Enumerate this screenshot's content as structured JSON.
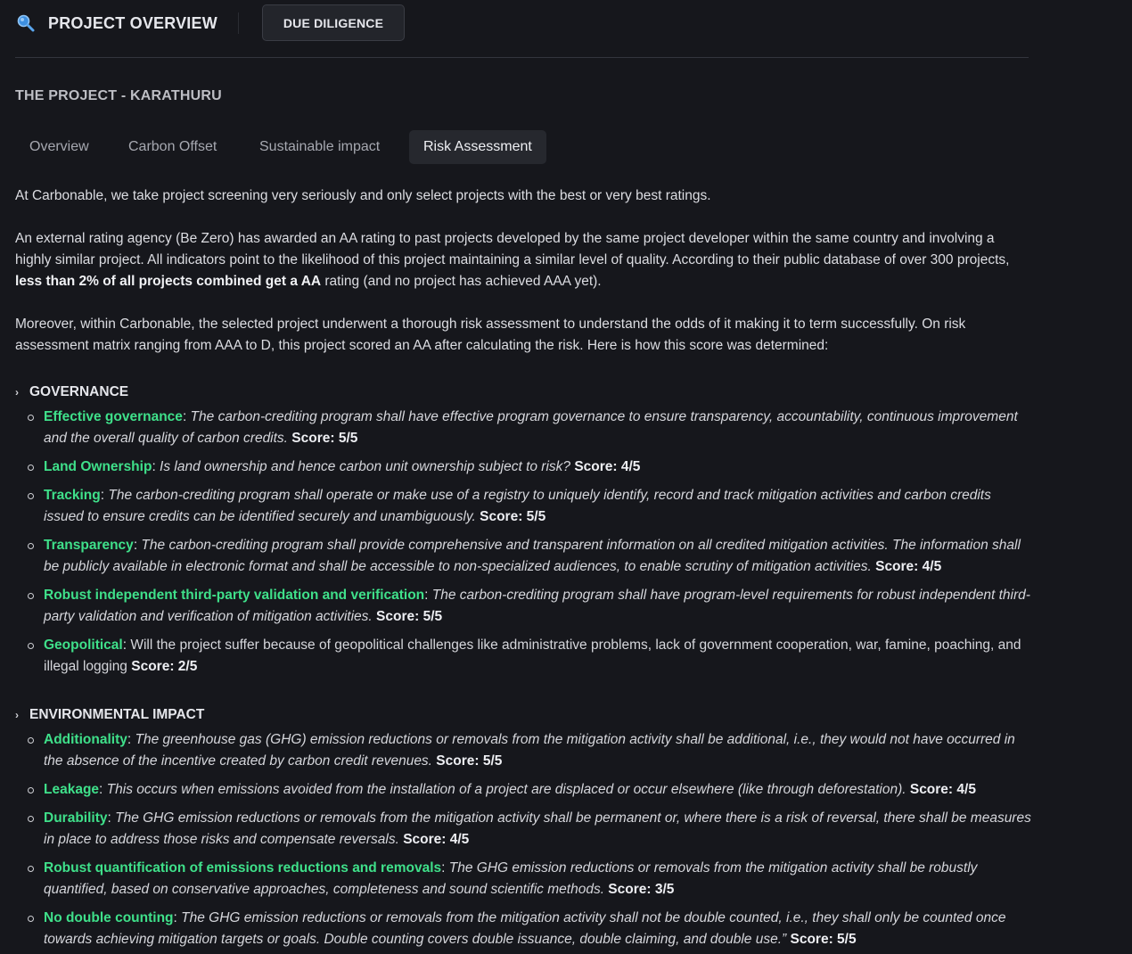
{
  "header": {
    "title": "PROJECT OVERVIEW",
    "due_diligence_label": "DUE DILIGENCE",
    "icon": "search-icon"
  },
  "project": {
    "title": "THE PROJECT - KARATHURU"
  },
  "tabs": [
    {
      "label": "Overview",
      "active": false
    },
    {
      "label": "Carbon Offset",
      "active": false
    },
    {
      "label": "Sustainable impact",
      "active": false
    },
    {
      "label": "Risk Assessment",
      "active": true
    }
  ],
  "intro": {
    "p1": "At Carbonable, we take project screening very seriously and only select projects with the best or very best ratings.",
    "p2_part1": "An external rating agency (Be Zero) has awarded an AA rating to past projects developed by the same project developer within the same country and involving a highly similar project. All indicators point to the likelihood of this project maintaining a similar level of quality. According to their public database of over 300 projects, ",
    "p2_bold": "less than 2% of all projects combined get a AA",
    "p2_part2": " rating (and no project has achieved AAA yet).",
    "p3": "Moreover, within Carbonable, the selected project underwent a thorough risk assessment to understand the odds of it making it to term successfully. On risk assessment matrix ranging from AAA to D, this project scored an AA after calculating the risk. Here is how this score was determined:"
  },
  "sections": [
    {
      "title": "GOVERNANCE",
      "items": [
        {
          "term": "Effective governance",
          "sep": ":",
          "desc": " The carbon-crediting program shall have effective program governance to ensure transparency, accountability, continuous improvement and the overall quality of carbon credits.",
          "score": " Score: 5/5",
          "italic": true
        },
        {
          "term": "Land Ownership",
          "sep": ":",
          "desc": " Is land ownership and hence carbon unit ownership subject to risk?",
          "score": " Score: 4/5",
          "italic": true
        },
        {
          "term": "Tracking",
          "sep": ":",
          "desc": " The carbon-crediting program shall operate or make use of a registry to uniquely identify, record and track mitigation activities and carbon credits issued to ensure credits can be identified securely and unambiguously.",
          "score": " Score: 5/5",
          "italic": true
        },
        {
          "term": "Transparency",
          "sep": ":",
          "desc": " The carbon-crediting program shall provide comprehensive and transparent information on all credited mitigation activities. The information shall be publicly available in electronic format and shall be accessible to non-specialized audiences, to enable scrutiny of mitigation activities.",
          "score": " Score: 4/5",
          "italic": true
        },
        {
          "term": "Robust independent third-party validation and verification",
          "sep": ":",
          "desc": " The carbon-crediting program shall have program-level requirements for robust independent third-party validation and verification of mitigation activities.",
          "score": " Score: 5/5",
          "italic": true
        },
        {
          "term": "Geopolitical",
          "sep": ":",
          "desc": " Will the project suffer because of geopolitical challenges like administrative problems, lack of government cooperation, war, famine, poaching, and illegal logging",
          "score": " Score: 2/5",
          "italic": false
        }
      ]
    },
    {
      "title": "ENVIRONMENTAL IMPACT",
      "items": [
        {
          "term": "Additionality",
          "sep": ":",
          "desc": " The greenhouse gas (GHG) emission reductions or removals from the mitigation activity shall be additional, i.e., they would not have occurred in the absence of the incentive created by carbon credit revenues.",
          "score": " Score: 5/5",
          "italic": true
        },
        {
          "term": "Leakage",
          "sep": ":",
          "desc": " This occurs when emissions avoided from the installation of a project are displaced or occur elsewhere (like through deforestation).",
          "score": " Score: 4/5",
          "italic": true
        },
        {
          "term": "Durability",
          "sep": ":",
          "desc": " The GHG emission reductions or removals from the mitigation activity shall be permanent or, where there is a risk of reversal, there shall be measures in place to address those risks and compensate reversals.",
          "score": " Score: 4/5",
          "italic": true
        },
        {
          "term": "Robust quantification of emissions reductions and removals",
          "sep": ":",
          "desc": " The GHG emission reductions or removals from the mitigation activity shall be robustly quantified, based on conservative approaches, completeness and sound scientific methods.",
          "score": " Score: 3/5",
          "italic": true
        },
        {
          "term": "No double counting",
          "sep": ":",
          "desc": " The GHG emission reductions or removals from the mitigation activity shall not be double counted, i.e., they shall only be counted once towards achieving mitigation targets or goals. Double counting covers double issuance, double claiming, and double use.”",
          "score": " Score: 5/5",
          "italic": true
        }
      ]
    }
  ],
  "colors": {
    "background": "#16171c",
    "accent_green": "#3fe08a",
    "text": "#dcdde2"
  }
}
